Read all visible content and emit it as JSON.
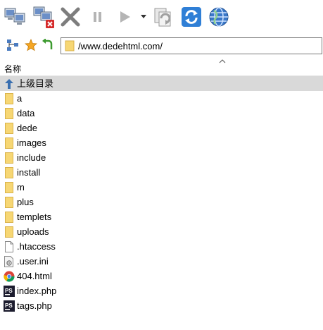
{
  "toolbar": {
    "buttons": [
      {
        "name": "connect",
        "icon": "computers-icon"
      },
      {
        "name": "disconnect",
        "icon": "disconnect-computer-icon"
      },
      {
        "name": "stop",
        "icon": "cancel-x-icon"
      },
      {
        "name": "pause",
        "icon": "pause-icon"
      },
      {
        "name": "play",
        "icon": "play-icon"
      },
      {
        "name": "play-menu",
        "icon": "dropdown-arrow-icon"
      },
      {
        "name": "queue",
        "icon": "copy-refresh-icon"
      },
      {
        "name": "refresh",
        "icon": "refresh-icon"
      },
      {
        "name": "browser",
        "icon": "globe-icon"
      }
    ]
  },
  "address": {
    "path": "/www.dedehtml.com/"
  },
  "header": {
    "name_column": "名称"
  },
  "files": {
    "parent": "上级目录",
    "items": [
      {
        "label": "a",
        "kind": "folder"
      },
      {
        "label": "data",
        "kind": "folder"
      },
      {
        "label": "dede",
        "kind": "folder"
      },
      {
        "label": "images",
        "kind": "folder"
      },
      {
        "label": "include",
        "kind": "folder"
      },
      {
        "label": "install",
        "kind": "folder"
      },
      {
        "label": "m",
        "kind": "folder"
      },
      {
        "label": "plus",
        "kind": "folder"
      },
      {
        "label": "templets",
        "kind": "folder"
      },
      {
        "label": "uploads",
        "kind": "folder"
      },
      {
        "label": ".htaccess",
        "kind": "file"
      },
      {
        "label": ".user.ini",
        "kind": "config"
      },
      {
        "label": "404.html",
        "kind": "html"
      },
      {
        "label": "index.php",
        "kind": "php"
      },
      {
        "label": "tags.php",
        "kind": "php"
      }
    ]
  },
  "colors": {
    "folder": "#f7d774",
    "folder_edge": "#d9b24a",
    "parent_row": "#d9d9d9",
    "refresh_blue": "#2f7fd6",
    "php_dark": "#1c1c2e"
  }
}
